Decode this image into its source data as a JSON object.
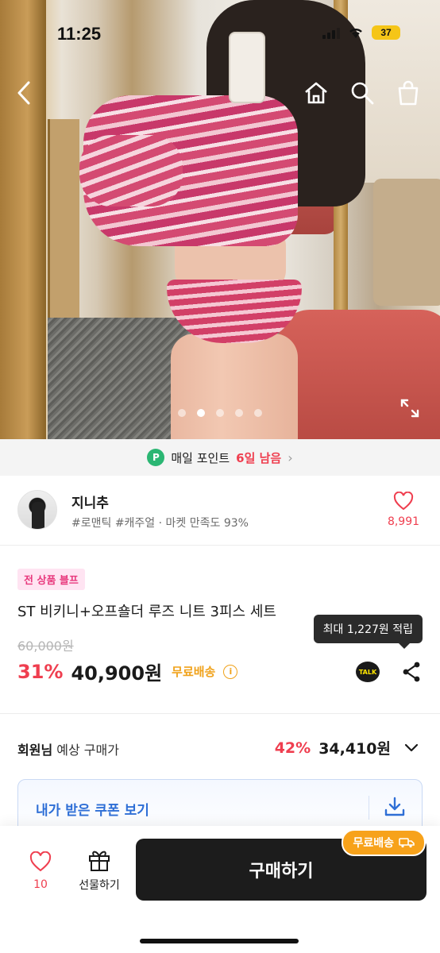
{
  "status": {
    "time": "11:25",
    "battery": "37"
  },
  "hero": {
    "slide_index": 2,
    "slide_count": 5
  },
  "point_banner": {
    "badge": "P",
    "text": "매일 포인트",
    "highlight": "6일 남음"
  },
  "shop": {
    "name": "지니추",
    "tags": "#로맨틱 #캐주얼 · 마켓 만족도 93%",
    "likes": "8,991"
  },
  "product": {
    "badge": "전 상품 블프",
    "title": "ST 비키니+오프숄더 루즈 니트 3피스 세트",
    "tooltip": "최대 1,227원 적립",
    "original_price": "60,000원",
    "discount": "31%",
    "price": "40,900원",
    "shipping": "무료배송",
    "talk_label": "TALK"
  },
  "member": {
    "label_bold": "회원님",
    "label": "예상 구매가",
    "discount": "42%",
    "price": "34,410원"
  },
  "coupon": {
    "label": "내가 받은 쿠폰 보기"
  },
  "bottom": {
    "like_count": "10",
    "gift_label": "선물하기",
    "buy_label": "구매하기",
    "ship_badge": "무료배송"
  },
  "colors": {
    "accent_red": "#ef3e4f",
    "shipping_orange": "#f0a21b",
    "coupon_blue": "#2f6fd6",
    "point_green": "#2bb673"
  }
}
